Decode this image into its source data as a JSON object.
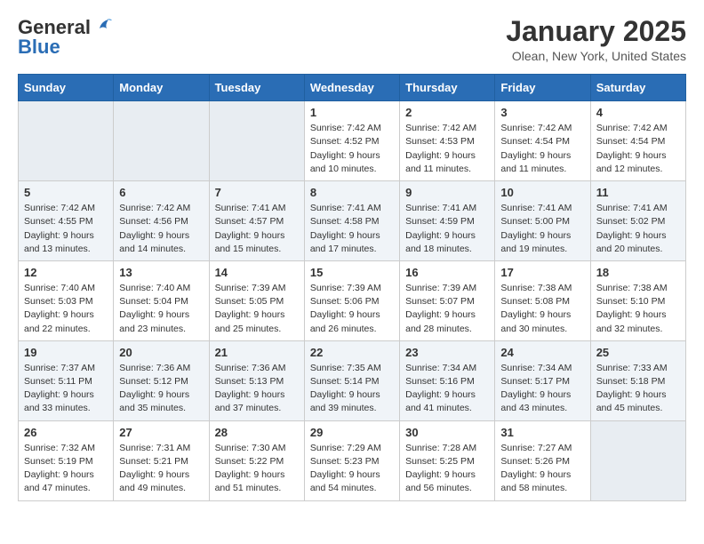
{
  "header": {
    "logo_general": "General",
    "logo_blue": "Blue",
    "month_title": "January 2025",
    "location": "Olean, New York, United States"
  },
  "days_of_week": [
    "Sunday",
    "Monday",
    "Tuesday",
    "Wednesday",
    "Thursday",
    "Friday",
    "Saturday"
  ],
  "weeks": [
    [
      {
        "day": "",
        "info": ""
      },
      {
        "day": "",
        "info": ""
      },
      {
        "day": "",
        "info": ""
      },
      {
        "day": "1",
        "info": "Sunrise: 7:42 AM\nSunset: 4:52 PM\nDaylight: 9 hours\nand 10 minutes."
      },
      {
        "day": "2",
        "info": "Sunrise: 7:42 AM\nSunset: 4:53 PM\nDaylight: 9 hours\nand 11 minutes."
      },
      {
        "day": "3",
        "info": "Sunrise: 7:42 AM\nSunset: 4:54 PM\nDaylight: 9 hours\nand 11 minutes."
      },
      {
        "day": "4",
        "info": "Sunrise: 7:42 AM\nSunset: 4:54 PM\nDaylight: 9 hours\nand 12 minutes."
      }
    ],
    [
      {
        "day": "5",
        "info": "Sunrise: 7:42 AM\nSunset: 4:55 PM\nDaylight: 9 hours\nand 13 minutes."
      },
      {
        "day": "6",
        "info": "Sunrise: 7:42 AM\nSunset: 4:56 PM\nDaylight: 9 hours\nand 14 minutes."
      },
      {
        "day": "7",
        "info": "Sunrise: 7:41 AM\nSunset: 4:57 PM\nDaylight: 9 hours\nand 15 minutes."
      },
      {
        "day": "8",
        "info": "Sunrise: 7:41 AM\nSunset: 4:58 PM\nDaylight: 9 hours\nand 17 minutes."
      },
      {
        "day": "9",
        "info": "Sunrise: 7:41 AM\nSunset: 4:59 PM\nDaylight: 9 hours\nand 18 minutes."
      },
      {
        "day": "10",
        "info": "Sunrise: 7:41 AM\nSunset: 5:00 PM\nDaylight: 9 hours\nand 19 minutes."
      },
      {
        "day": "11",
        "info": "Sunrise: 7:41 AM\nSunset: 5:02 PM\nDaylight: 9 hours\nand 20 minutes."
      }
    ],
    [
      {
        "day": "12",
        "info": "Sunrise: 7:40 AM\nSunset: 5:03 PM\nDaylight: 9 hours\nand 22 minutes."
      },
      {
        "day": "13",
        "info": "Sunrise: 7:40 AM\nSunset: 5:04 PM\nDaylight: 9 hours\nand 23 minutes."
      },
      {
        "day": "14",
        "info": "Sunrise: 7:39 AM\nSunset: 5:05 PM\nDaylight: 9 hours\nand 25 minutes."
      },
      {
        "day": "15",
        "info": "Sunrise: 7:39 AM\nSunset: 5:06 PM\nDaylight: 9 hours\nand 26 minutes."
      },
      {
        "day": "16",
        "info": "Sunrise: 7:39 AM\nSunset: 5:07 PM\nDaylight: 9 hours\nand 28 minutes."
      },
      {
        "day": "17",
        "info": "Sunrise: 7:38 AM\nSunset: 5:08 PM\nDaylight: 9 hours\nand 30 minutes."
      },
      {
        "day": "18",
        "info": "Sunrise: 7:38 AM\nSunset: 5:10 PM\nDaylight: 9 hours\nand 32 minutes."
      }
    ],
    [
      {
        "day": "19",
        "info": "Sunrise: 7:37 AM\nSunset: 5:11 PM\nDaylight: 9 hours\nand 33 minutes."
      },
      {
        "day": "20",
        "info": "Sunrise: 7:36 AM\nSunset: 5:12 PM\nDaylight: 9 hours\nand 35 minutes."
      },
      {
        "day": "21",
        "info": "Sunrise: 7:36 AM\nSunset: 5:13 PM\nDaylight: 9 hours\nand 37 minutes."
      },
      {
        "day": "22",
        "info": "Sunrise: 7:35 AM\nSunset: 5:14 PM\nDaylight: 9 hours\nand 39 minutes."
      },
      {
        "day": "23",
        "info": "Sunrise: 7:34 AM\nSunset: 5:16 PM\nDaylight: 9 hours\nand 41 minutes."
      },
      {
        "day": "24",
        "info": "Sunrise: 7:34 AM\nSunset: 5:17 PM\nDaylight: 9 hours\nand 43 minutes."
      },
      {
        "day": "25",
        "info": "Sunrise: 7:33 AM\nSunset: 5:18 PM\nDaylight: 9 hours\nand 45 minutes."
      }
    ],
    [
      {
        "day": "26",
        "info": "Sunrise: 7:32 AM\nSunset: 5:19 PM\nDaylight: 9 hours\nand 47 minutes."
      },
      {
        "day": "27",
        "info": "Sunrise: 7:31 AM\nSunset: 5:21 PM\nDaylight: 9 hours\nand 49 minutes."
      },
      {
        "day": "28",
        "info": "Sunrise: 7:30 AM\nSunset: 5:22 PM\nDaylight: 9 hours\nand 51 minutes."
      },
      {
        "day": "29",
        "info": "Sunrise: 7:29 AM\nSunset: 5:23 PM\nDaylight: 9 hours\nand 54 minutes."
      },
      {
        "day": "30",
        "info": "Sunrise: 7:28 AM\nSunset: 5:25 PM\nDaylight: 9 hours\nand 56 minutes."
      },
      {
        "day": "31",
        "info": "Sunrise: 7:27 AM\nSunset: 5:26 PM\nDaylight: 9 hours\nand 58 minutes."
      },
      {
        "day": "",
        "info": ""
      }
    ]
  ]
}
